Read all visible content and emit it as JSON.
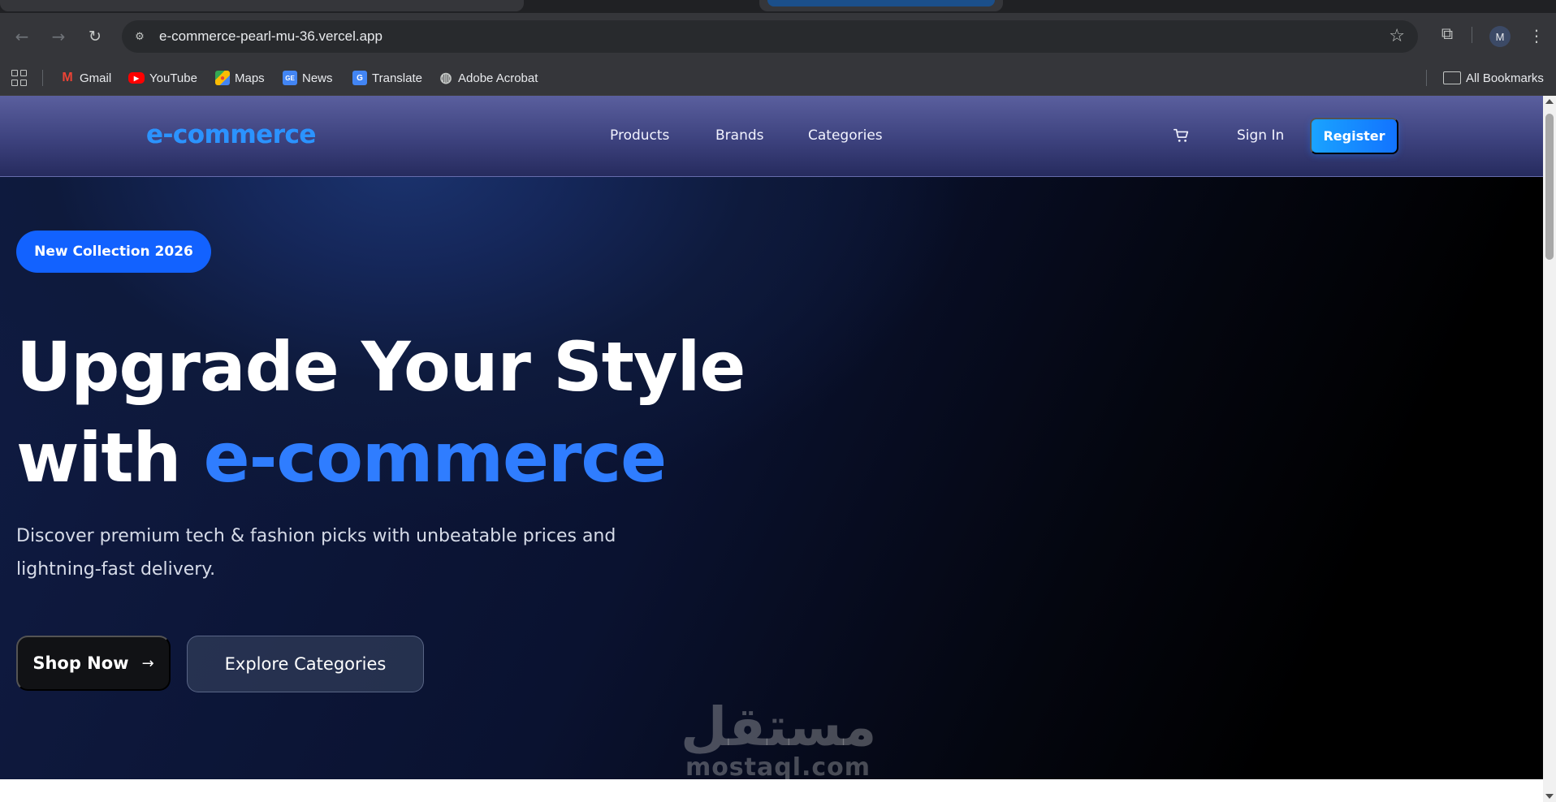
{
  "browser": {
    "url": "e-commerce-pearl-mu-36.vercel.app",
    "profile_initial": "M",
    "bookmarks": [
      {
        "label": "Gmail",
        "icon": "gmail-icon"
      },
      {
        "label": "YouTube",
        "icon": "youtube-icon"
      },
      {
        "label": "Maps",
        "icon": "maps-icon"
      },
      {
        "label": "News",
        "icon": "news-icon"
      },
      {
        "label": "Translate",
        "icon": "translate-icon"
      },
      {
        "label": "Adobe Acrobat",
        "icon": "acrobat-icon"
      }
    ],
    "all_bookmarks": "All Bookmarks"
  },
  "site": {
    "logo": "e-commerce",
    "nav": {
      "products": "Products",
      "brands": "Brands",
      "categories": "Categories"
    },
    "sign_in": "Sign In",
    "register": "Register"
  },
  "hero": {
    "badge": "New Collection 2026",
    "headline_line1": "Upgrade Your Style",
    "headline_line2_prefix": "with ",
    "headline_accent": "e-commerce",
    "subtitle": "Discover premium tech & fashion picks with unbeatable prices and lightning-fast delivery.",
    "cta_primary": "Shop Now",
    "cta_secondary": "Explore Categories"
  },
  "watermark": {
    "arabic": "مستقل",
    "latin": "mostaql.com"
  },
  "colors": {
    "accent_blue": "#2f7dff",
    "register_gradient_start": "#1aa3ff",
    "register_gradient_end": "#1273ff",
    "badge_blue": "#1262ff",
    "nav_gradient_top": "#5a5f9e",
    "nav_gradient_bottom": "#262b5e"
  }
}
